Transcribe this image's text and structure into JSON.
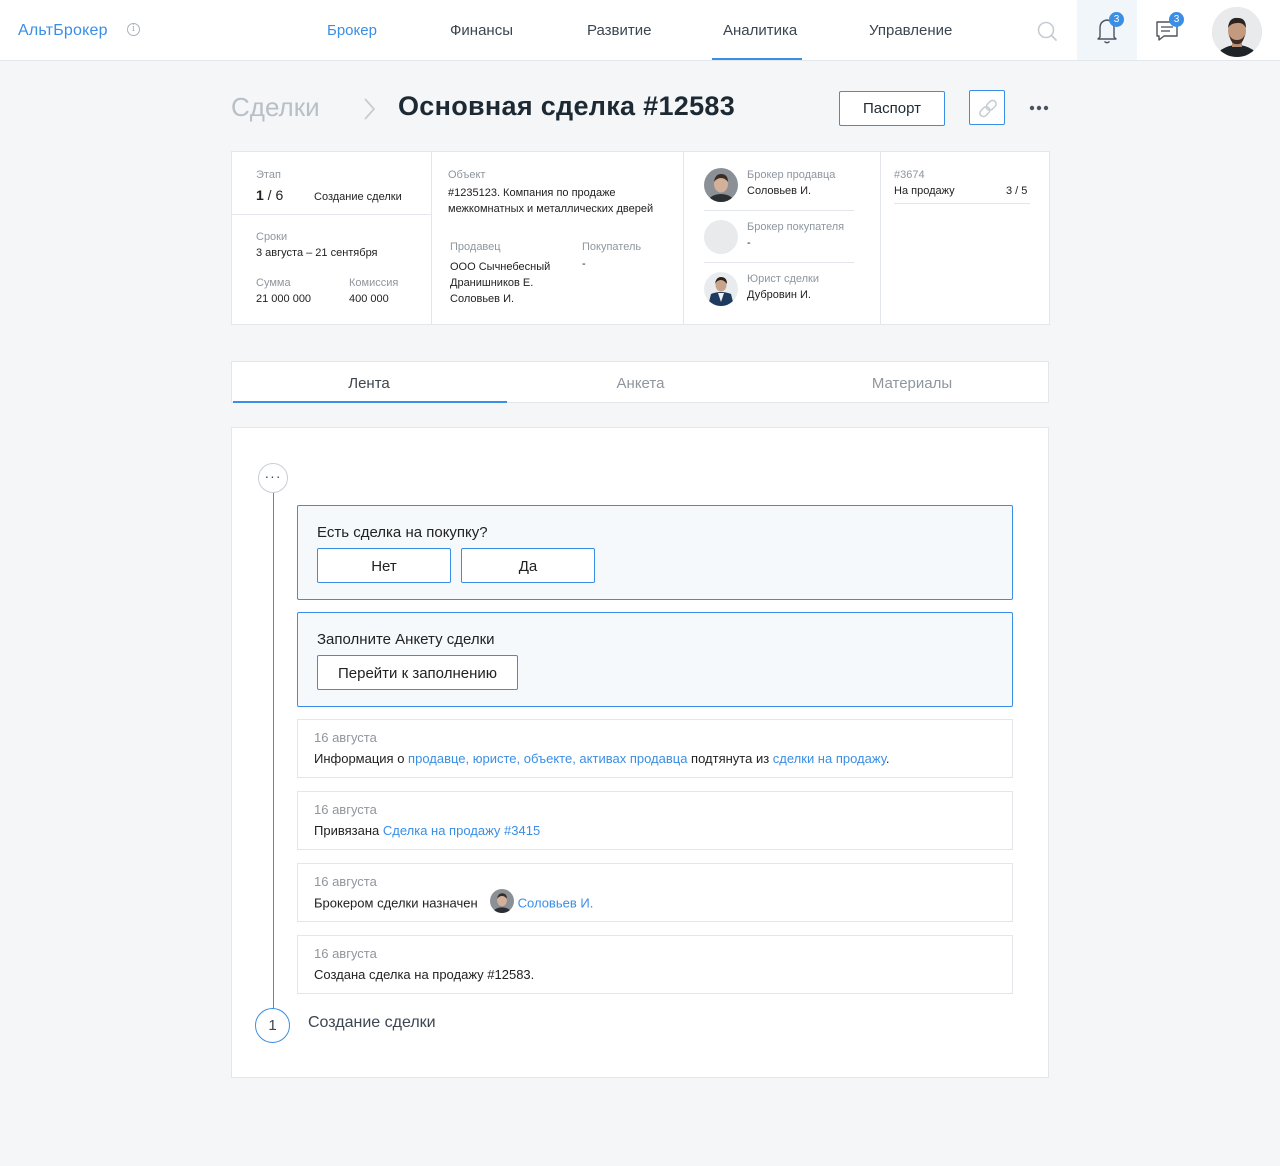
{
  "app": {
    "logo": "АльтБрокер",
    "info_glyph": "i"
  },
  "nav": {
    "items": [
      {
        "label": "Брокер",
        "active": true
      },
      {
        "label": "Финансы",
        "active": false
      },
      {
        "label": "Развитие",
        "active": false
      },
      {
        "label": "Аналитика",
        "active": false
      },
      {
        "label": "Управление",
        "active": false
      }
    ],
    "notifications_count": "3",
    "messages_count": "3"
  },
  "header": {
    "breadcrumb": "Сделки",
    "title": "Основная сделка #12583",
    "passport_label": "Паспорт"
  },
  "info": {
    "stage_label": "Этап",
    "stage_current": "1",
    "stage_total": " / 6",
    "stage_name": "Создание сделки",
    "terms_label": "Сроки",
    "terms_value": "3 августа – 21 сентября",
    "sum_label": "Сумма",
    "sum_value": "21 000 000",
    "commission_label": "Комиссия",
    "commission_value": "400 000",
    "object_label": "Объект",
    "object_value_line1": "#1235123. Компания по продаже",
    "object_value_line2": "межкомнатных и металлических дверей",
    "seller_label": "Продавец",
    "seller_line1": "ООО Сычнебесный",
    "seller_line2": "Дранишников Е.",
    "seller_line3": "Соловьев И.",
    "buyer_label": "Покупатель",
    "buyer_value": "-",
    "seller_broker_label": "Брокер продавца",
    "seller_broker_name": "Соловьев И.",
    "buyer_broker_label": "Брокер покупателя",
    "buyer_broker_name": "-",
    "lawyer_label": "Юрист сделки",
    "lawyer_name": "Дубровин И.",
    "linked_id": "#3674",
    "linked_type": "На продажу",
    "linked_progress": "3 / 5"
  },
  "tabs": [
    {
      "label": "Лента",
      "active": true
    },
    {
      "label": "Анкета",
      "active": false
    },
    {
      "label": "Материалы",
      "active": false
    }
  ],
  "feed": {
    "more_glyph": "···",
    "question1": "Есть сделка на покупку?",
    "btn_no": "Нет",
    "btn_yes": "Да",
    "question2": "Заполните Анкету сделки",
    "btn_fill": "Перейти к заполнению",
    "events": [
      {
        "date": "16 августа",
        "t1": "Информация о ",
        "l1": "продавце, юристе, объекте, активах продавца",
        "t2": " подтянута из ",
        "l2": "сделки на продажу",
        "t3": "."
      },
      {
        "date": "16 августа",
        "t1": "Привязана ",
        "l1": "Сделка на продажу #3415"
      },
      {
        "date": "16 августа",
        "t1": "Брокером сделки назначен",
        "l1": "Соловьев И."
      },
      {
        "date": "16 августа",
        "t1": "Создана сделка на продажу #12583."
      }
    ],
    "stage_number": "1",
    "stage_label": "Создание сделки"
  },
  "colors": {
    "accent": "#3a8ee6",
    "background": "#f4f6f8",
    "border": "#e3e6ea"
  }
}
